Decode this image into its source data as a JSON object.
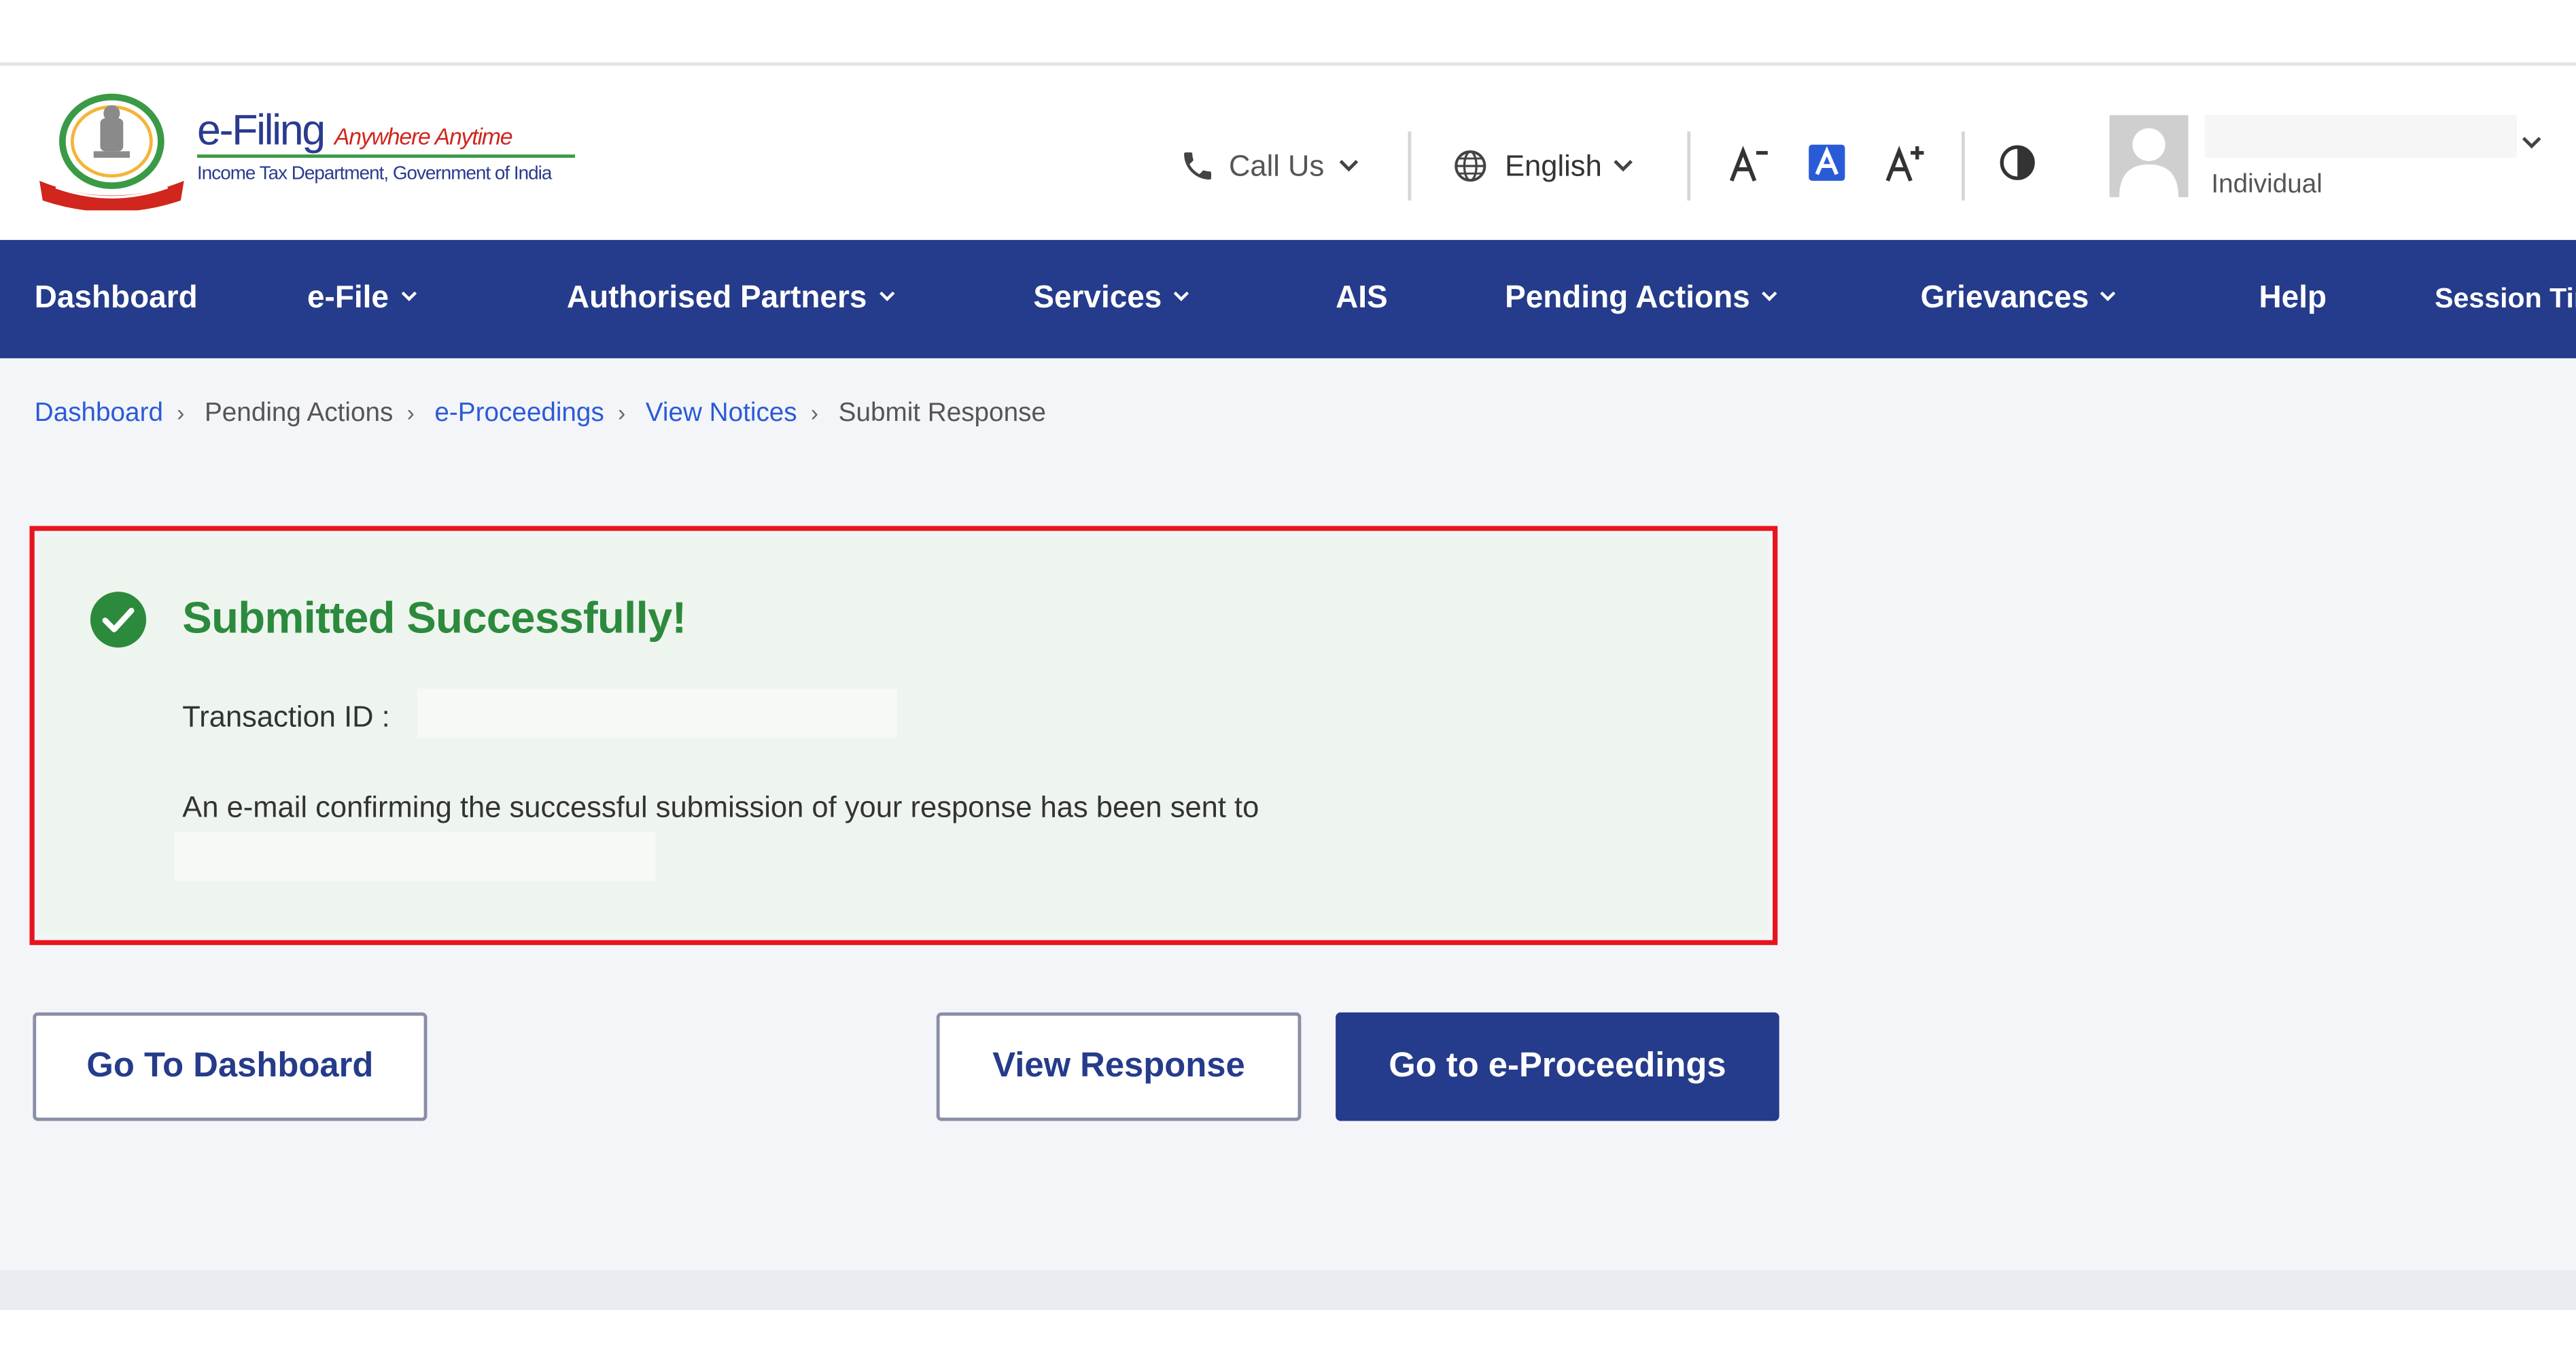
{
  "header": {
    "logo": {
      "brand": "e-Filing",
      "tagline": "Anywhere Anytime",
      "subtitle": "Income Tax Department, Government of India"
    },
    "call_us": "Call Us",
    "language": "English",
    "user_role": "Individual"
  },
  "nav": {
    "items": [
      {
        "label": "Dashboard"
      },
      {
        "label": "e-File"
      },
      {
        "label": "Authorised Partners"
      },
      {
        "label": "Services"
      },
      {
        "label": "AIS"
      },
      {
        "label": "Pending Actions"
      },
      {
        "label": "Grievances"
      },
      {
        "label": "Help"
      },
      {
        "label": "Session Tir"
      }
    ]
  },
  "breadcrumb": [
    {
      "label": "Dashboard"
    },
    {
      "label": "Pending Actions"
    },
    {
      "label": "e-Proceedings"
    },
    {
      "label": "View Notices"
    },
    {
      "label": "Submit Response"
    }
  ],
  "success_panel": {
    "title": "Submitted Successfully!",
    "transaction_label": "Transaction ID :",
    "email_message": "An e-mail confirming the successful submission of your response has been sent to"
  },
  "buttons": {
    "go_to_dashboard": "Go To Dashboard",
    "view_response": "View Response",
    "go_to_proceedings": "Go to e-Proceedings"
  },
  "colors": {
    "nav_bg": "#253B8B",
    "success_green": "#2c8a3d",
    "highlight_red": "#e8141b",
    "link_blue": "#2a5bd7"
  }
}
